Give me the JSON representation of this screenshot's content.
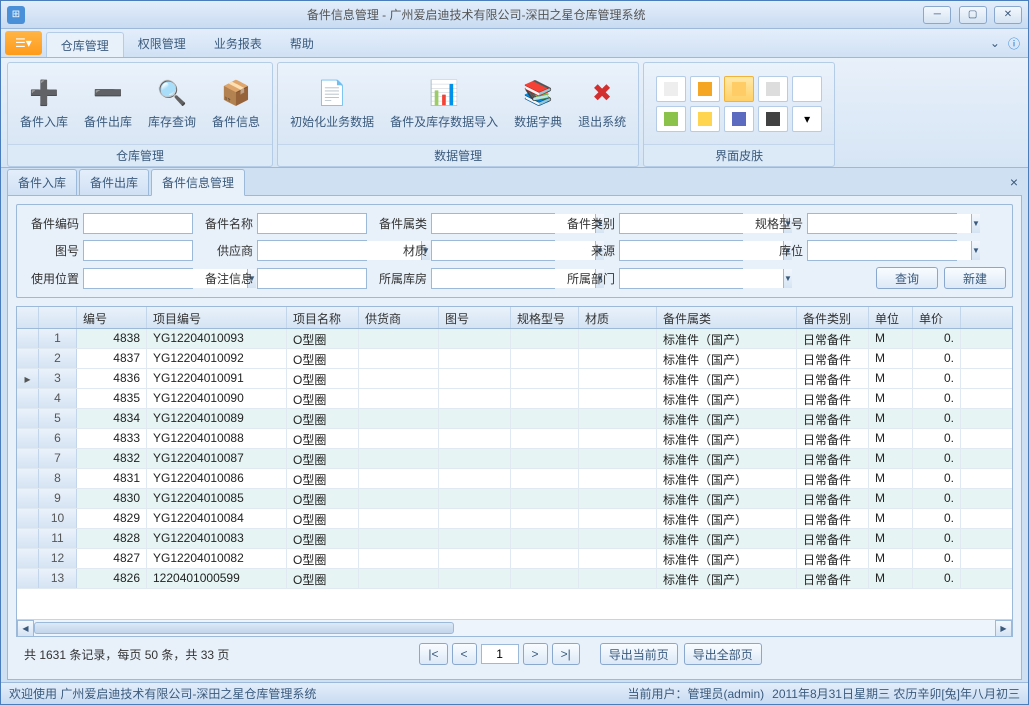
{
  "window": {
    "title": "备件信息管理 - 广州爱启迪技术有限公司-深田之星仓库管理系统"
  },
  "menu": {
    "primary": "☰▾",
    "items": [
      "仓库管理",
      "权限管理",
      "业务报表",
      "帮助"
    ],
    "active": 0
  },
  "ribbon": {
    "group1": {
      "label": "仓库管理",
      "btns": [
        {
          "label": "备件入库",
          "icon": "➕",
          "color": "#f5a623"
        },
        {
          "label": "备件出库",
          "icon": "➖",
          "color": "#d0021b"
        },
        {
          "label": "库存查询",
          "icon": "🔍",
          "color": "#4a90e2"
        },
        {
          "label": "备件信息",
          "icon": "📦",
          "color": "#f8e71c"
        }
      ]
    },
    "group2": {
      "label": "数据管理",
      "btns": [
        {
          "label": "初始化业务数据",
          "icon": "📄",
          "color": "#4a90e2"
        },
        {
          "label": "备件及库存数据导入",
          "icon": "📊",
          "color": "#2e7d32"
        },
        {
          "label": "数据字典",
          "icon": "📚",
          "color": "#1565c0"
        },
        {
          "label": "退出系统",
          "icon": "✖",
          "color": "#d32f2f"
        }
      ]
    },
    "group3": {
      "label": "界面皮肤"
    }
  },
  "tabs": {
    "items": [
      "备件入库",
      "备件出库",
      "备件信息管理"
    ],
    "active": 2
  },
  "filters": {
    "labels": {
      "code": "备件编码",
      "name": "备件名称",
      "attr": "备件属类",
      "cat": "备件类别",
      "spec": "规格型号",
      "draw": "图号",
      "supplier": "供应商",
      "material": "材质",
      "source": "来源",
      "loc": "库位",
      "usepos": "使用位置",
      "remark": "备注信息",
      "warehouse": "所属库房",
      "dept": "所属部门"
    },
    "buttons": {
      "query": "查询",
      "new": "新建"
    }
  },
  "grid": {
    "columns": [
      "编号",
      "项目编号",
      "项目名称",
      "供货商",
      "图号",
      "规格型号",
      "材质",
      "备件属类",
      "备件类别",
      "单位",
      "单价"
    ],
    "rows": [
      {
        "idx": 1,
        "no": 4838,
        "pno": "YG12204010093",
        "pname": "O型圈",
        "attr": "标准件（国产）",
        "cat": "日常备件",
        "unit": "M",
        "price": "0."
      },
      {
        "idx": 2,
        "no": 4837,
        "pno": "YG12204010092",
        "pname": "O型圈",
        "attr": "标准件（国产）",
        "cat": "日常备件",
        "unit": "M",
        "price": "0."
      },
      {
        "idx": 3,
        "no": 4836,
        "pno": "YG12204010091",
        "pname": "O型圈",
        "attr": "标准件（国产）",
        "cat": "日常备件",
        "unit": "M",
        "price": "0.",
        "selected": true
      },
      {
        "idx": 4,
        "no": 4835,
        "pno": "YG12204010090",
        "pname": "O型圈",
        "attr": "标准件（国产）",
        "cat": "日常备件",
        "unit": "M",
        "price": "0."
      },
      {
        "idx": 5,
        "no": 4834,
        "pno": "YG12204010089",
        "pname": "O型圈",
        "attr": "标准件（国产）",
        "cat": "日常备件",
        "unit": "M",
        "price": "0."
      },
      {
        "idx": 6,
        "no": 4833,
        "pno": "YG12204010088",
        "pname": "O型圈",
        "attr": "标准件（国产）",
        "cat": "日常备件",
        "unit": "M",
        "price": "0."
      },
      {
        "idx": 7,
        "no": 4832,
        "pno": "YG12204010087",
        "pname": "O型圈",
        "attr": "标准件（国产）",
        "cat": "日常备件",
        "unit": "M",
        "price": "0."
      },
      {
        "idx": 8,
        "no": 4831,
        "pno": "YG12204010086",
        "pname": "O型圈",
        "attr": "标准件（国产）",
        "cat": "日常备件",
        "unit": "M",
        "price": "0."
      },
      {
        "idx": 9,
        "no": 4830,
        "pno": "YG12204010085",
        "pname": "O型圈",
        "attr": "标准件（国产）",
        "cat": "日常备件",
        "unit": "M",
        "price": "0."
      },
      {
        "idx": 10,
        "no": 4829,
        "pno": "YG12204010084",
        "pname": "O型圈",
        "attr": "标准件（国产）",
        "cat": "日常备件",
        "unit": "M",
        "price": "0."
      },
      {
        "idx": 11,
        "no": 4828,
        "pno": "YG12204010083",
        "pname": "O型圈",
        "attr": "标准件（国产）",
        "cat": "日常备件",
        "unit": "M",
        "price": "0."
      },
      {
        "idx": 12,
        "no": 4827,
        "pno": "YG12204010082",
        "pname": "O型圈",
        "attr": "标准件（国产）",
        "cat": "日常备件",
        "unit": "M",
        "price": "0."
      },
      {
        "idx": 13,
        "no": 4826,
        "pno": "1220401000599",
        "pname": "O型圈",
        "attr": "标准件（国产）",
        "cat": "日常备件",
        "unit": "M",
        "price": "0."
      }
    ]
  },
  "pager": {
    "summary": "共 1631 条记录，每页 50 条，共 33 页",
    "page": "1",
    "first": "|<",
    "prev": "<",
    "next": ">",
    "last": ">|",
    "export_current": "导出当前页",
    "export_all": "导出全部页"
  },
  "status": {
    "left": "欢迎使用 广州爱启迪技术有限公司-深田之星仓库管理系统",
    "user": "当前用户：管理员(admin)",
    "date": "2011年8月31日星期三 农历辛卯[兔]年八月初三"
  }
}
